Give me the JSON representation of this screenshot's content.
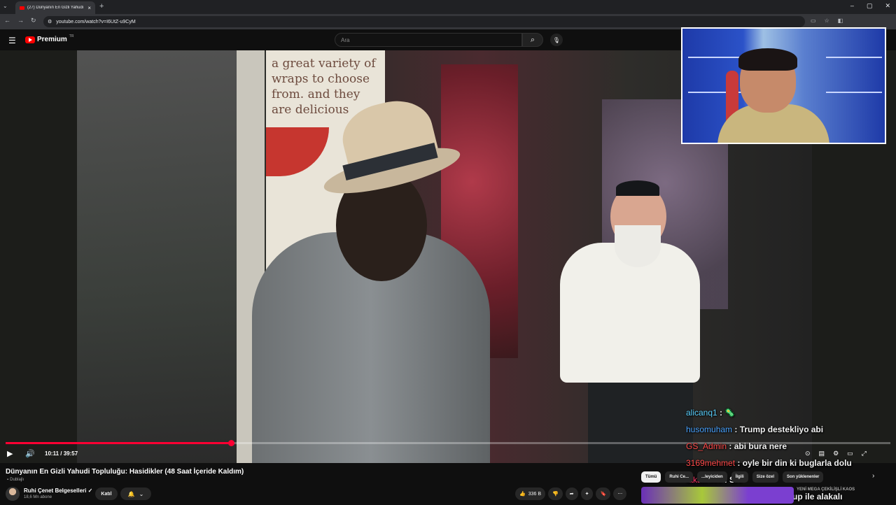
{
  "browser": {
    "tab_title": "(27) Dünyanın En Gizli Yahudi T",
    "url": "youtube.com/watch?v=I6UtZ-u9CyM"
  },
  "header": {
    "logo": "Premium",
    "logo_region": "TR",
    "search_placeholder": "Ara"
  },
  "video": {
    "current_time": "10:11",
    "duration": "39:57",
    "progress_fraction": 0.255,
    "poster_text": "a great variety of wraps to choose from. and they are delicious"
  },
  "chat": [
    {
      "user": "alicanq1",
      "text": "",
      "color": "#5ad1ff",
      "emoji": "🦠"
    },
    {
      "user": "husomuham",
      "text": "Trump destekliyo abi",
      "color": "#4aa3ff"
    },
    {
      "user": "GS_Admin",
      "text": "abi bura nere",
      "color": "#ff4a4a"
    },
    {
      "user": "3169mehmet",
      "text": "oyle bir din ki buglarla dolu",
      "color": "#ff4a4a"
    },
    {
      "user": "takashi66",
      "text": "SA",
      "color": "#ff3a6a"
    },
    {
      "user": "tEstoskijr",
      "text": "ilerde soylüyo trup ile alakalı",
      "color": "#3a6aff"
    }
  ],
  "meta": {
    "title": "Dünyanın En Gizli Yahudi Topluluğu: Hasidikler (48 Saat İçeride Kaldım)",
    "dubbed": "Dublajlı",
    "channel": "Ruhi Çenet Belgeselleri",
    "subscribers": "18,6 Mn abone",
    "join_label": "Katıl",
    "likes": "336 B"
  },
  "chips": [
    "Tümü",
    "Ruhi Ce...",
    "...leyiciden",
    "İlgili",
    "Size özel",
    "Son yüklenenler"
  ],
  "recommendation": {
    "title": "YENİ MEGA ÇEKİLİŞLİ KAOS"
  },
  "colors": {
    "progress": "#ff0033",
    "brand": "#ff0000"
  }
}
